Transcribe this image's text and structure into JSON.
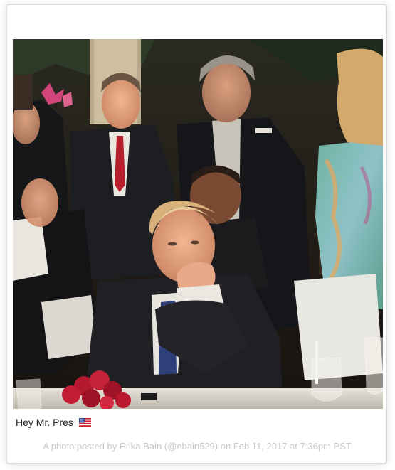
{
  "post": {
    "caption_text": "Hey Mr. Pres",
    "caption_emoji": "flag-us-icon",
    "attribution": "A photo posted by Erika Bain (@ebain529) on Feb 11, 2017 at 7:36pm PST"
  },
  "colors": {
    "caption": "#262626",
    "attribution": "#c9c8cd",
    "card_border": "#dbdbdb"
  }
}
